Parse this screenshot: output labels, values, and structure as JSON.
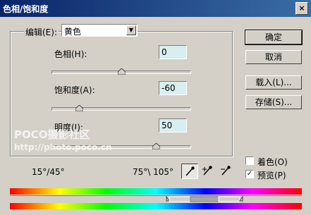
{
  "window": {
    "title": "色相/饱和度",
    "close_glyph": "×"
  },
  "edit": {
    "label": "编辑(E):",
    "selected": "黄色"
  },
  "hue": {
    "label": "色相(H):",
    "value": "0",
    "slider_fraction": 0.5
  },
  "saturation": {
    "label": "饱和度(A):",
    "value": "-60",
    "slider_fraction": 0.2
  },
  "lightness": {
    "label": "明度(I):",
    "value": "50",
    "slider_fraction": 0.75
  },
  "buttons": {
    "ok": "确定",
    "cancel": "取消",
    "load": "载入(L)...",
    "save": "存储(S)..."
  },
  "colorize": {
    "label": "着色(O)",
    "checked": false
  },
  "preview": {
    "label": "预览(P)",
    "checked": true
  },
  "range": {
    "left_text": "15°/45°",
    "right_text": "75°\\ 105°"
  },
  "watermark": {
    "line1": "POCO摄影社区",
    "line2": "http://photo.poco.cn"
  },
  "icons": [
    "close-icon",
    "dropdown-arrow-icon",
    "eyedropper-icon",
    "eyedropper-plus-icon",
    "eyedropper-minus-icon"
  ]
}
